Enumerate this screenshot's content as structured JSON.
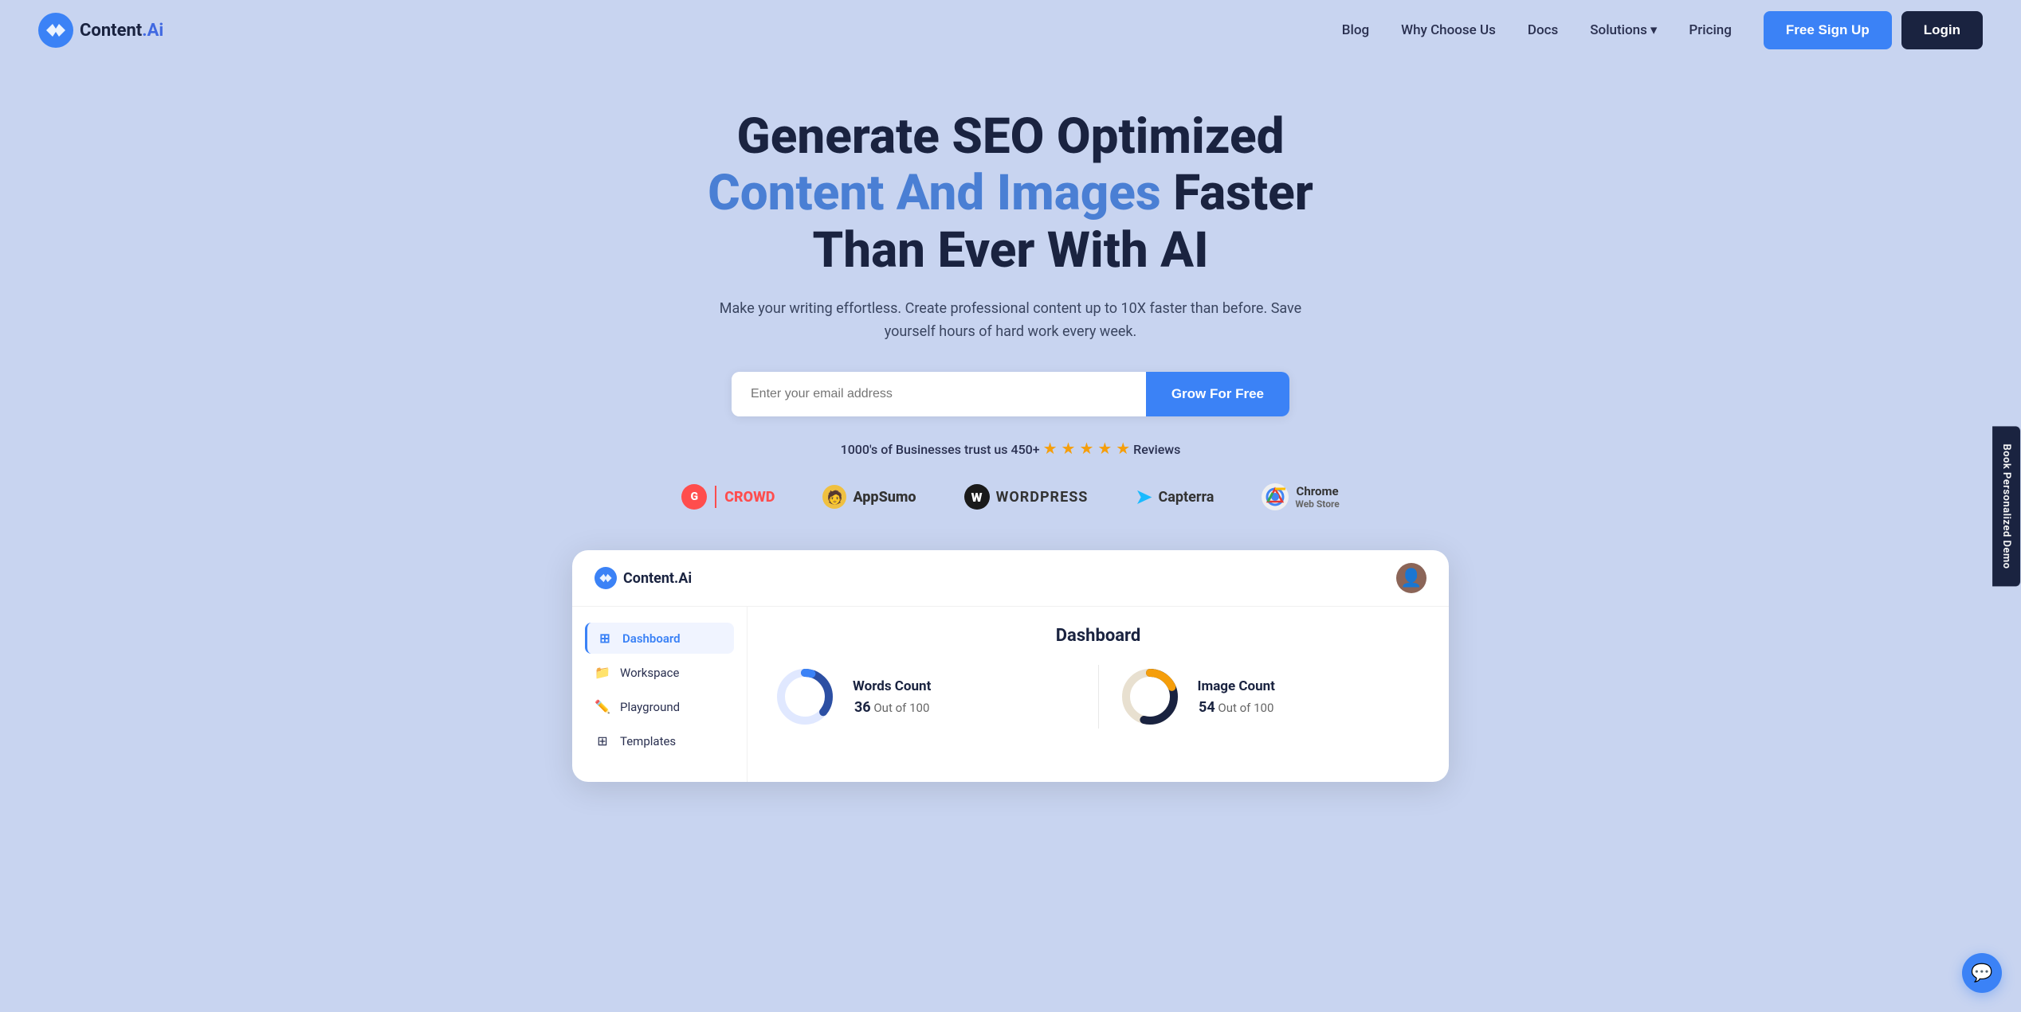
{
  "brand": {
    "name": "Content",
    "suffix": ".Ai",
    "tagline": "Content.Ai"
  },
  "nav": {
    "blog_label": "Blog",
    "why_choose_us_label": "Why Choose Us",
    "docs_label": "Docs",
    "solutions_label": "Solutions",
    "pricing_label": "Pricing",
    "signup_label": "Free Sign Up",
    "login_label": "Login"
  },
  "hero": {
    "title_part1": "Generate SEO Optimized ",
    "title_highlight": "Content And Images",
    "title_part2": " Faster Than Ever With AI",
    "subtitle": "Make your writing effortless. Create professional content up to 10X faster than before. Save yourself hours of hard work every week.",
    "email_placeholder": "Enter your email address",
    "cta_label": "Grow For Free",
    "trust_text": "1000's of Businesses trust us 450+",
    "trust_reviews": "Reviews"
  },
  "brands": [
    {
      "name": "G2 Crowd",
      "type": "g2"
    },
    {
      "name": "AppSumo",
      "type": "appsumo"
    },
    {
      "name": "WordPress",
      "type": "wordpress"
    },
    {
      "name": "Capterra",
      "type": "capterra"
    },
    {
      "name": "Chrome Web Store",
      "type": "chrome"
    }
  ],
  "dashboard": {
    "logo": "Content.Ai",
    "title": "Dashboard",
    "sidebar": [
      {
        "label": "Dashboard",
        "icon": "grid",
        "active": true
      },
      {
        "label": "Workspace",
        "icon": "folder",
        "active": false
      },
      {
        "label": "Playground",
        "icon": "edit",
        "active": false
      },
      {
        "label": "Templates",
        "icon": "apps",
        "active": false
      }
    ],
    "stats": [
      {
        "label": "Words Count",
        "value": "36",
        "total": "100",
        "value_text": "36 Out of 100",
        "color_primary": "#2c4fa3",
        "color_secondary": "#3b82f6",
        "percent": 36
      },
      {
        "label": "Image Count",
        "value": "54",
        "total": "100",
        "value_text": "54 Out of 100",
        "color_primary": "#1a2340",
        "color_secondary": "#f59e0b",
        "percent": 54
      }
    ]
  },
  "side_tab": {
    "label": "Book Personalized Demo"
  },
  "chat": {
    "icon": "💬"
  }
}
